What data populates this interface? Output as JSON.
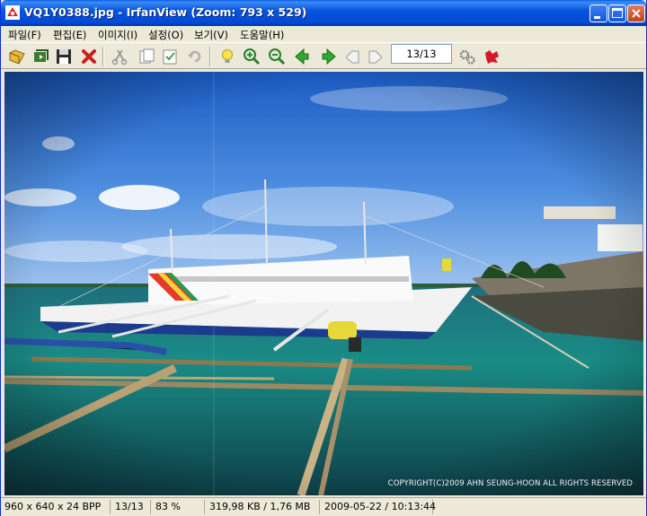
{
  "window": {
    "title": "VQ1Y0388.jpg - IrfanView (Zoom: 793 x 529)"
  },
  "menu": {
    "items": [
      {
        "label": "파일(F)"
      },
      {
        "label": "편집(E)"
      },
      {
        "label": "이미지(I)"
      },
      {
        "label": "설정(O)"
      },
      {
        "label": "보기(V)"
      },
      {
        "label": "도움말(H)"
      }
    ]
  },
  "toolbar": {
    "page_indicator": "13/13"
  },
  "image": {
    "copyright": "COPYRIGHT(C)2009 AHN SEUNG-HOON ALL RIGHTS RESERVED"
  },
  "status": {
    "dimensions": "960 x 640 x 24 BPP",
    "page": "13/13",
    "zoom": "83 %",
    "filesize": "319,98 KB / 1,76 MB",
    "datetime": "2009-05-22 / 10:13:44"
  }
}
